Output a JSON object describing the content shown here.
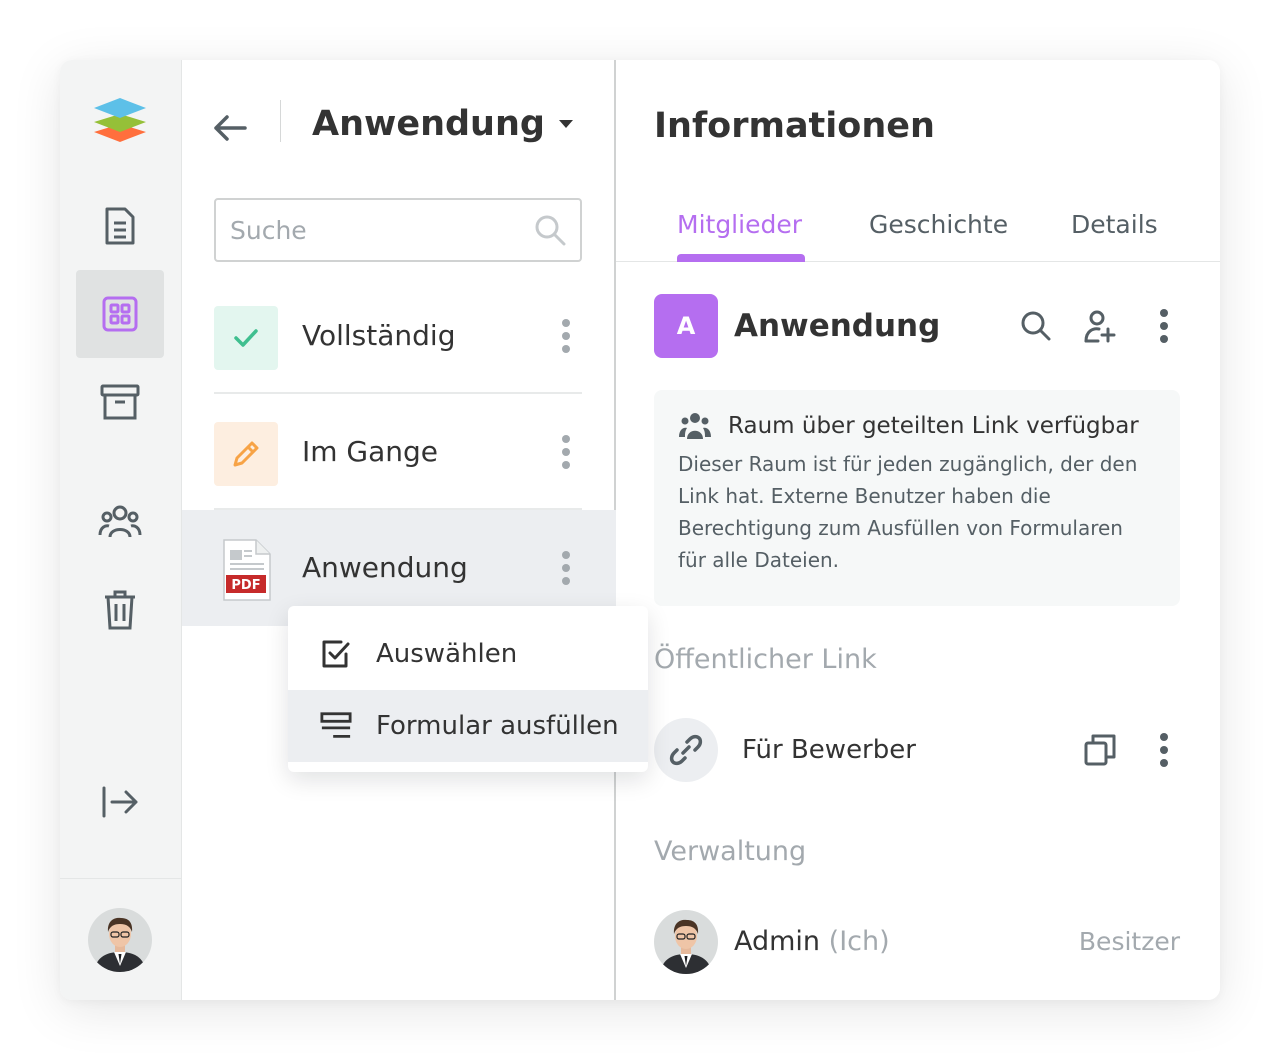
{
  "brand_colors": {
    "accent": "#b56ef0",
    "success": "#3fbf8f",
    "progress": "#f7a346",
    "pdf_red": "#c62a2a"
  },
  "sidebar": {
    "items": [
      {
        "icon": "logo-icon"
      },
      {
        "icon": "document-icon"
      },
      {
        "icon": "rooms-grid-icon",
        "active": true
      },
      {
        "icon": "archive-icon"
      },
      {
        "icon": "people-icon"
      },
      {
        "icon": "trash-icon"
      },
      {
        "icon": "collapse-arrow-icon"
      }
    ],
    "user_avatar": "user-avatar"
  },
  "files": {
    "room_title": "Anwendung",
    "search_placeholder": "Suche",
    "rows": [
      {
        "label": "Vollständig",
        "icon": "check-icon"
      },
      {
        "label": "Im Gange",
        "icon": "pencil-icon"
      },
      {
        "label": "Anwendung",
        "icon": "pdf-icon",
        "badge": "PDF"
      }
    ]
  },
  "context_menu": {
    "items": [
      {
        "label": "Auswählen",
        "icon": "select-checkbox-icon"
      },
      {
        "label": "Formular ausfüllen",
        "icon": "form-fill-icon"
      }
    ]
  },
  "info": {
    "title": "Informationen",
    "tabs": [
      {
        "label": "Mitglieder",
        "active": true
      },
      {
        "label": "Geschichte"
      },
      {
        "label": "Details"
      }
    ],
    "room": {
      "initial": "A",
      "name": "Anwendung"
    },
    "notice": {
      "title": "Raum über geteilten Link verfügbar",
      "body": "Dieser Raum ist für jeden zugänglich, der den Link hat. Externe Benutzer haben die Berechtigung zum Ausfüllen von Formularen für alle Dateien."
    },
    "public_link_heading": "Öffentlicher Link",
    "public_link": {
      "name": "Für Bewerber"
    },
    "admin_heading": "Verwaltung",
    "admin": {
      "name": "Admin",
      "me_suffix": "(Ich)",
      "role": "Besitzer"
    }
  }
}
